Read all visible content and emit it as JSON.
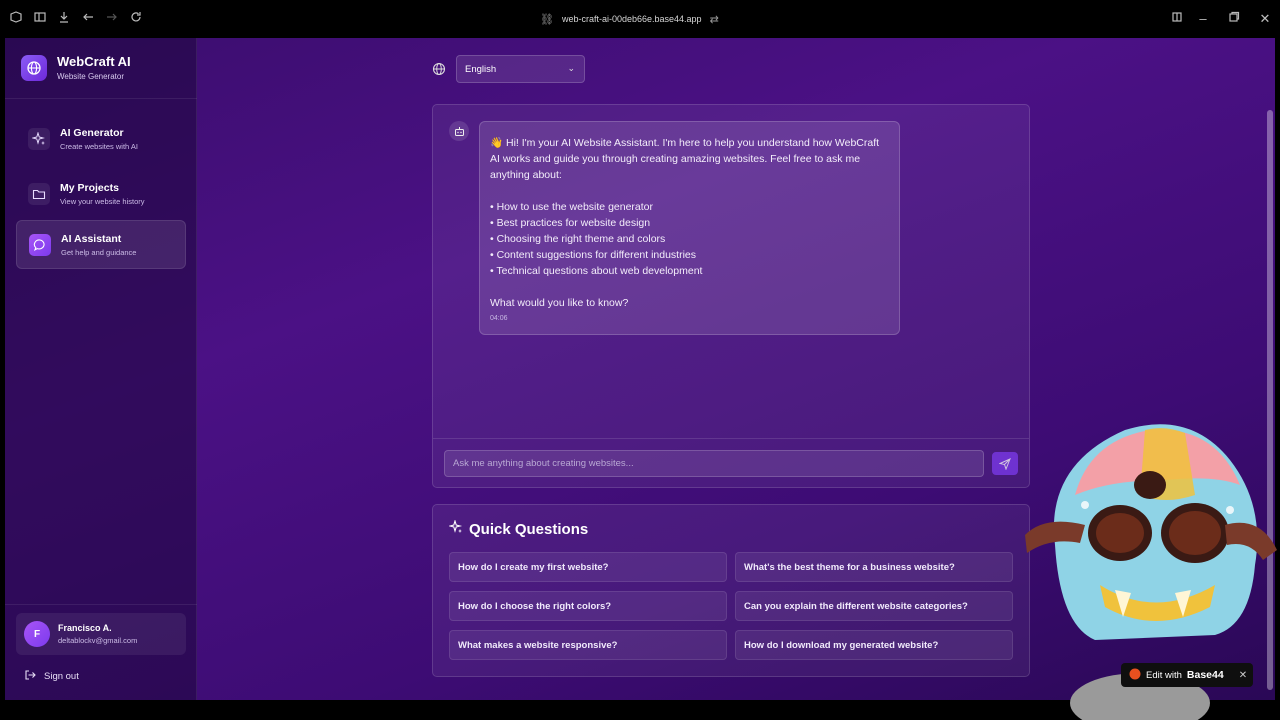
{
  "browser": {
    "url": "web-craft-ai-00deb66e.base44.app"
  },
  "brand": {
    "title": "WebCraft AI",
    "subtitle": "Website Generator"
  },
  "sidebar": {
    "items": [
      {
        "label": "AI Generator",
        "sub": "Create websites with AI",
        "icon": "sparkles-icon"
      },
      {
        "label": "My Projects",
        "sub": "View your website history",
        "icon": "folder-icon"
      },
      {
        "label": "AI Assistant",
        "sub": "Get help and guidance",
        "icon": "chat-icon",
        "active": true
      }
    ]
  },
  "user": {
    "initial": "F",
    "name": "Francisco A.",
    "email": "deltablockv@gmail.com"
  },
  "signout_label": "Sign out",
  "language": {
    "selected": "English"
  },
  "chat": {
    "message": "👋 Hi! I'm your AI Website Assistant. I'm here to help you understand how WebCraft AI works and guide you through creating amazing websites. Feel free to ask me anything about:\n\n• How to use the website generator\n• Best practices for website design\n• Choosing the right theme and colors\n• Content suggestions for different industries\n• Technical questions about web development\n\nWhat would you like to know?",
    "time": "04:06",
    "placeholder": "Ask me anything about creating websites..."
  },
  "quick_questions": {
    "title": "Quick Questions",
    "items": [
      "How do I create my first website?",
      "What's the best theme for a business website?",
      "How do I choose the right colors?",
      "Can you explain the different website categories?",
      "What makes a website responsive?",
      "How do I download my generated website?"
    ]
  },
  "badge": {
    "edit_with": "Edit with",
    "brand": "Base44",
    "close": "✕"
  },
  "colors": {
    "accent": "#7c3aed",
    "background": "#4b1185"
  }
}
